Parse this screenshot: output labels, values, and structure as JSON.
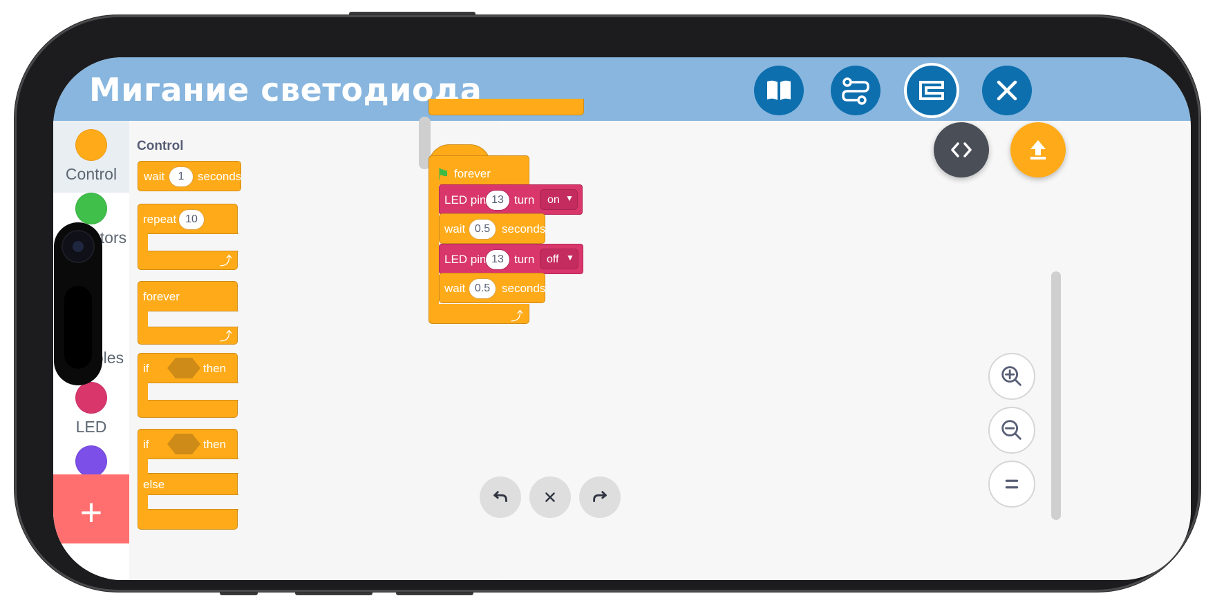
{
  "app": {
    "title": "Мигание светодиода"
  },
  "header_buttons": [
    "book-icon",
    "circuit-icon",
    "blocks-icon",
    "close-icon"
  ],
  "categories": [
    {
      "label": "Control",
      "color": "#ffab19"
    },
    {
      "label": "Operators",
      "color": "#40bf4a"
    },
    {
      "label": "Variables",
      "color": "#ff8c1a"
    },
    {
      "label": "LED",
      "color": "#d9366c"
    },
    {
      "label": "",
      "color": "#7b4fe8"
    }
  ],
  "add_button": "+",
  "flyout": {
    "title": "Control",
    "wait": {
      "pre": "wait",
      "value": "1",
      "post": "seconds"
    },
    "repeat": {
      "pre": "repeat",
      "value": "10"
    },
    "forever": {
      "label": "forever"
    },
    "if_then": {
      "pre": "if",
      "post": "then"
    },
    "if_else": {
      "pre": "if",
      "post": "then",
      "else": "else"
    }
  },
  "script": {
    "hat": "forever",
    "led1": {
      "pre": "LED pin",
      "pin": "13",
      "mid": "turn",
      "state": "on"
    },
    "wait1": {
      "pre": "wait",
      "value": "0.5",
      "post": "seconds"
    },
    "led2": {
      "pre": "LED pin",
      "pin": "13",
      "mid": "turn",
      "state": "off"
    },
    "wait2": {
      "pre": "wait",
      "value": "0.5",
      "post": "seconds"
    }
  },
  "colors": {
    "header": "#88b6de",
    "control": "#ffab19",
    "led": "#d9366c",
    "upload": "#ffab19",
    "code": "#4a4f57"
  }
}
